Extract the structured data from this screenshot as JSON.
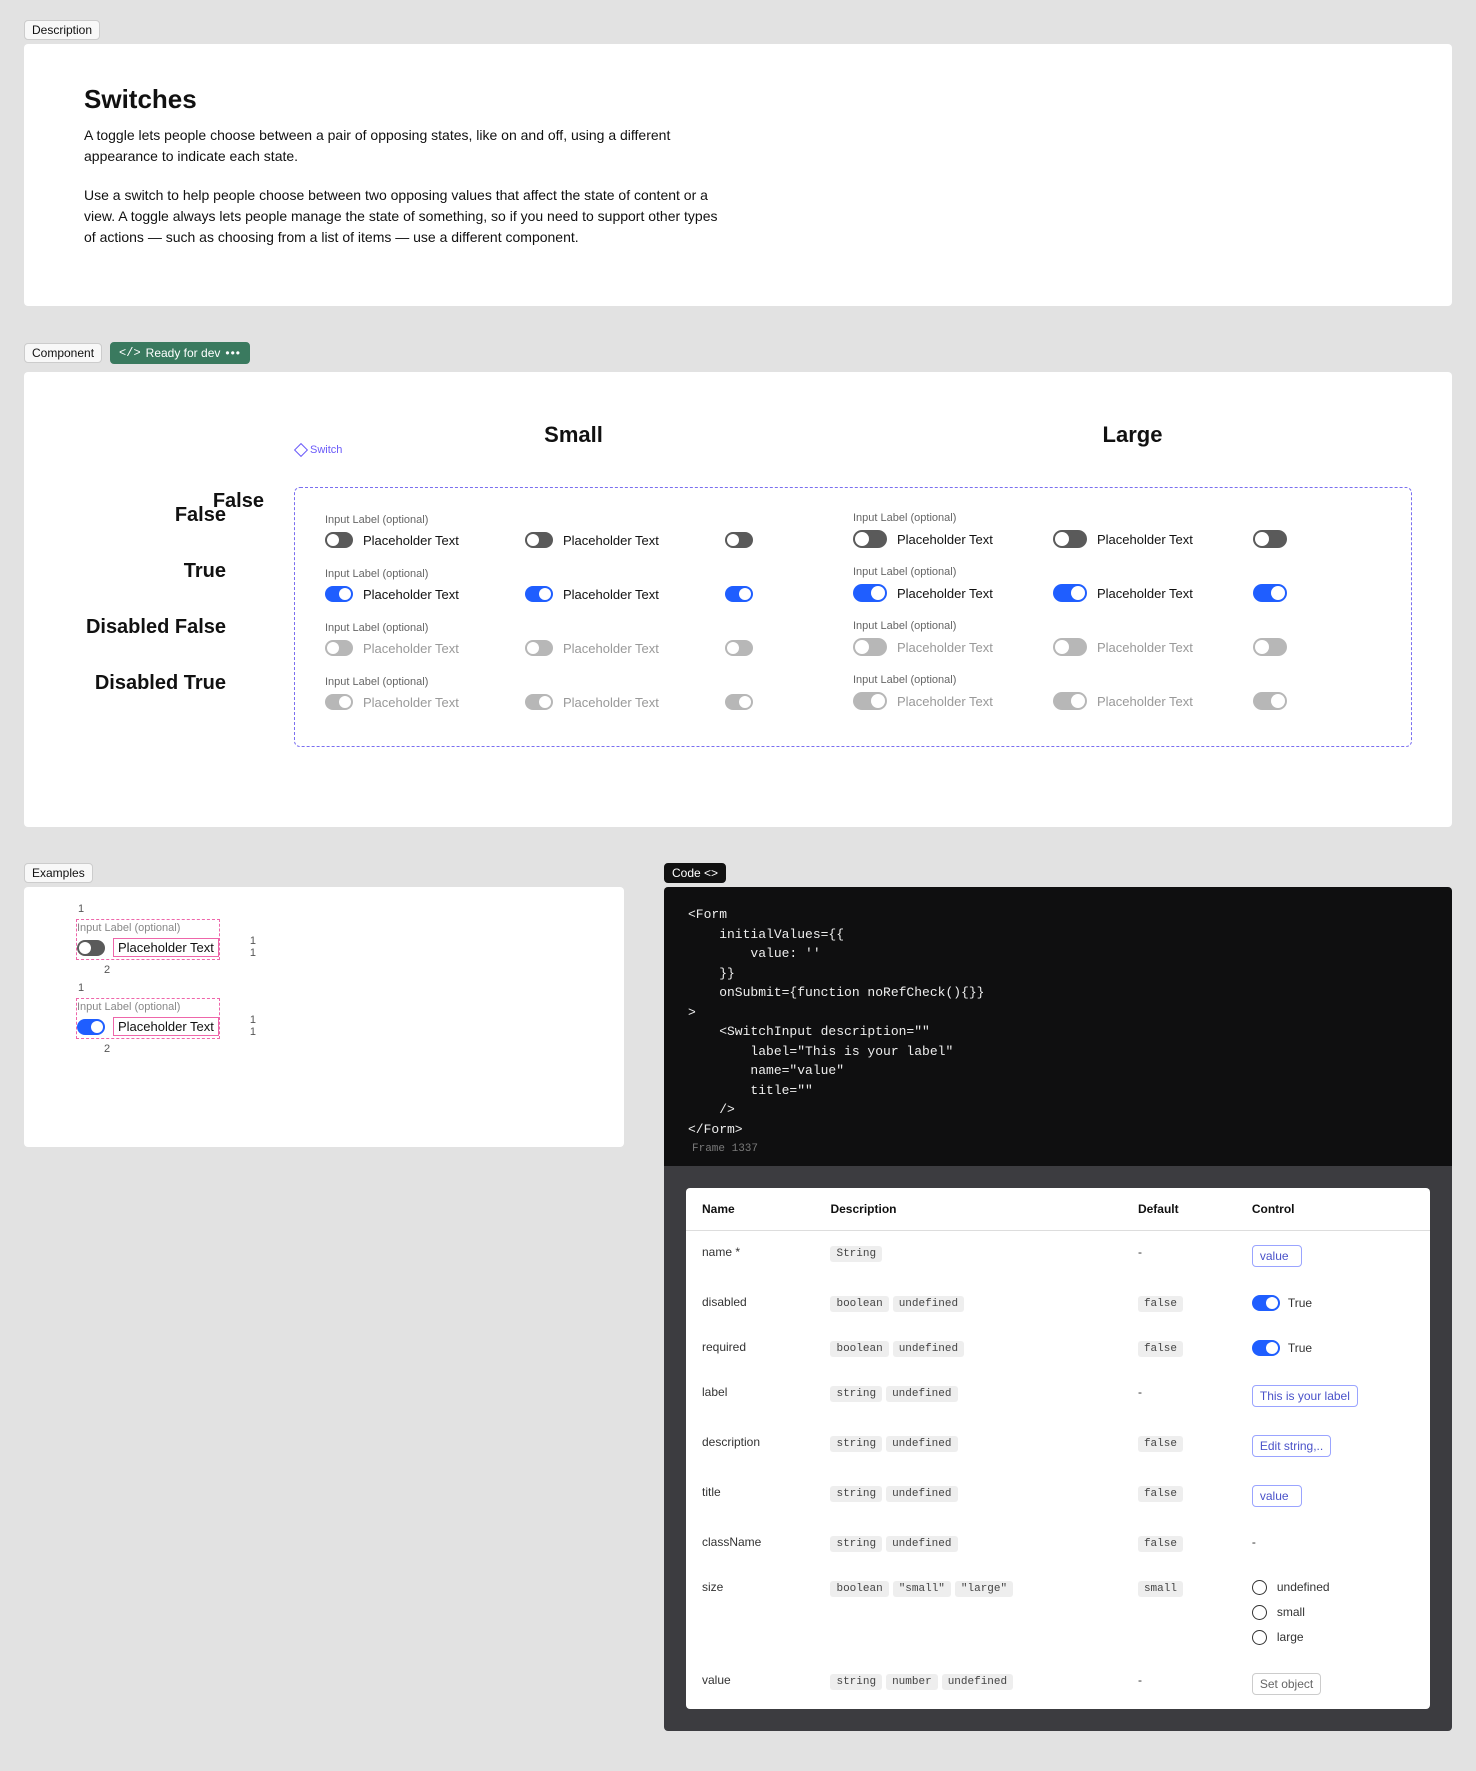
{
  "tags": {
    "description": "Description",
    "component": "Component",
    "ready": "Ready for dev",
    "examples": "Examples",
    "code": "Code <>"
  },
  "description": {
    "title": "Switches",
    "p1": "A toggle lets people choose between a pair of opposing states, like on and off, using a different appearance to indicate each state.",
    "p2": "Use a switch to help people choose between two opposing values that affect the state of content or a view. A toggle always lets people manage the state of something, so if you need to support other types of actions — such as choosing from a list of items — use a different component."
  },
  "sizes": {
    "small": "Small",
    "large": "Large"
  },
  "frame_label": "Switch",
  "rows": {
    "false": "False",
    "true": "True",
    "disabled_false": "Disabled False",
    "disabled_true": "Disabled True"
  },
  "cell": {
    "input_label": "Input Label (optional)",
    "placeholder": "Placeholder Text"
  },
  "code": "<Form\n    initialValues={{\n        value: ''\n    }}\n    onSubmit={function noRefCheck(){}}\n>\n    <SwitchInput description=\"\"\n        label=\"This is your label\"\n        name=\"value\"\n        title=\"\"\n    />\n</Form>",
  "code_frame": "Frame 1337",
  "controls": {
    "headers": {
      "name": "Name",
      "description": "Description",
      "default": "Default",
      "control": "Control"
    },
    "rows": [
      {
        "name": "name *",
        "types": [
          "String"
        ],
        "default": "-",
        "control": {
          "kind": "input",
          "value": "value"
        }
      },
      {
        "name": "disabled",
        "types": [
          "boolean",
          "undefined"
        ],
        "default": "false",
        "control": {
          "kind": "switch",
          "value": "True"
        }
      },
      {
        "name": "required",
        "types": [
          "boolean",
          "undefined"
        ],
        "default": "false",
        "control": {
          "kind": "switch",
          "value": "True"
        }
      },
      {
        "name": "label",
        "types": [
          "string",
          "undefined"
        ],
        "default": "-",
        "control": {
          "kind": "input",
          "value": "This is your label"
        }
      },
      {
        "name": "description",
        "types": [
          "string",
          "undefined"
        ],
        "default": "false",
        "control": {
          "kind": "input",
          "value": "Edit string,.."
        }
      },
      {
        "name": "title",
        "types": [
          "string",
          "undefined"
        ],
        "default": "false",
        "control": {
          "kind": "input",
          "value": "value"
        }
      },
      {
        "name": "className",
        "types": [
          "string",
          "undefined"
        ],
        "default": "false",
        "control": {
          "kind": "text",
          "value": "-"
        }
      },
      {
        "name": "size",
        "types": [
          "boolean",
          "\"small\"",
          "\"large\""
        ],
        "default": "small",
        "control": {
          "kind": "radio",
          "options": [
            "undefined",
            "small",
            "large"
          ]
        }
      },
      {
        "name": "value",
        "types": [
          "string",
          "number",
          "undefined"
        ],
        "default": "-",
        "control": {
          "kind": "plain-input",
          "value": "Set object"
        }
      }
    ]
  },
  "ex_nums": {
    "one": "1",
    "two": "2"
  }
}
